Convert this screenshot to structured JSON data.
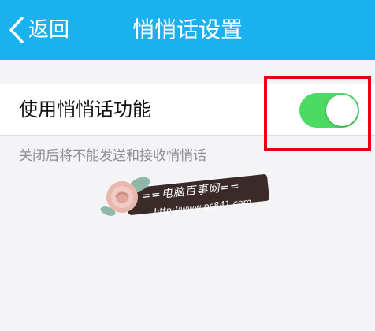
{
  "header": {
    "back_label": "返回",
    "title": "悄悄话设置"
  },
  "setting": {
    "label": "使用悄悄话功能",
    "enabled": true
  },
  "hint": "关闭后将不能发送和接收悄悄话",
  "watermark": {
    "title": "==电脑百事网==",
    "url": "http://www.pc841.com"
  },
  "colors": {
    "header_bg": "#1ab2ee",
    "toggle_on": "#4cd964",
    "highlight": "#e60012"
  },
  "icons": {
    "back": "chevron-left-icon",
    "watermark_logo": "rose-icon"
  }
}
